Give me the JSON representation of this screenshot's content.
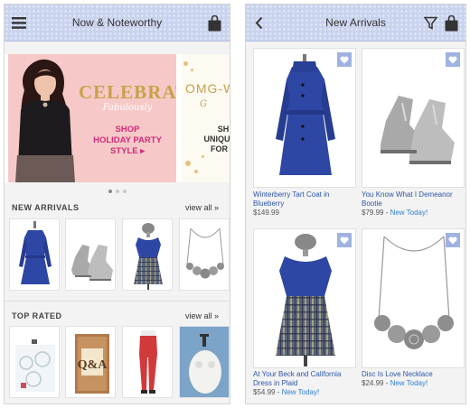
{
  "left_screen": {
    "header": {
      "title": "Now & Noteworthy",
      "menu_icon": "hamburger-menu-icon",
      "bag_icon": "shopping-bag-icon"
    },
    "carousel": {
      "slide1": {
        "headline": "CELEBRATE",
        "script": "Fabulously",
        "cta_line1": "SHOP",
        "cta_line2": "HOLIDAY PARTY",
        "cta_line3": "STYLE ▸"
      },
      "slide2": {
        "headline": "OMG-W",
        "script": "G",
        "text": "SH\nUNIQUE F\nFOR C"
      },
      "page_count": 3,
      "active_page": 1
    },
    "sections": [
      {
        "title": "NEW ARRIVALS",
        "view_all": "view all »",
        "items": [
          "blue-coat",
          "gray-booties",
          "plaid-dress",
          "silver-necklace"
        ]
      },
      {
        "title": "TOP RATED",
        "view_all": "view all »",
        "items": [
          "glass-ornaments",
          "qa-book",
          "red-pants",
          "owl-soap-dispenser"
        ]
      }
    ]
  },
  "right_screen": {
    "header": {
      "title": "New Arrivals",
      "back_icon": "back-chevron-icon",
      "filter_icon": "filter-funnel-icon",
      "bag_icon": "shopping-bag-icon"
    },
    "products": [
      {
        "name": "Winterberry Tart Coat in Blueberry",
        "price": "$149.99",
        "badge": ""
      },
      {
        "name": "You Know What I Demeanor Bootie",
        "price": "$79.99",
        "badge": "New Today!"
      },
      {
        "name": "At Your Beck and California Dress in Plaid",
        "price": "$54.99",
        "badge": "New Today!"
      },
      {
        "name": "Disc Is Love Necklace",
        "price": "$24.99",
        "badge": "New Today!"
      }
    ]
  },
  "colors": {
    "nav_bar": "#c9d3ee",
    "link_blue": "#2d55a8",
    "new_today": "#2f7fcc",
    "heart_badge": "#9fb2e2",
    "promo_pink": "#f6c9c8",
    "promo_gold": "#c8a14a",
    "promo_magenta": "#d02a7a"
  }
}
